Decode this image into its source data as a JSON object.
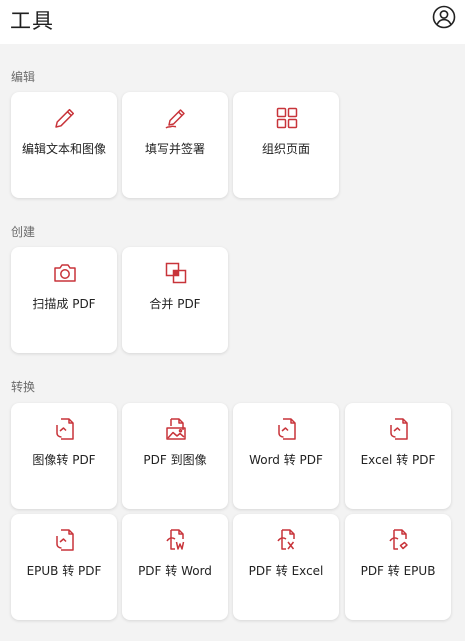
{
  "header": {
    "title": "工具"
  },
  "sections": {
    "edit": {
      "label": "编辑",
      "items": [
        "编辑文本和图像",
        "填写并签署",
        "组织页面"
      ]
    },
    "create": {
      "label": "创建",
      "items": [
        "扫描成 PDF",
        "合并 PDF"
      ]
    },
    "convert": {
      "label": "转换",
      "items": [
        "图像转 PDF",
        "PDF 到图像",
        "Word 转 PDF",
        "Excel 转 PDF",
        "EPUB 转 PDF",
        "PDF 转 Word",
        "PDF 转 Excel",
        "PDF 转 EPUB"
      ]
    }
  },
  "icons": {
    "edit": [
      "pencil-icon",
      "pen-sign-icon",
      "grid-icon"
    ],
    "create": [
      "camera-icon",
      "merge-icon"
    ],
    "convert": [
      "image-to-pdf-icon",
      "pdf-to-image-icon",
      "word-to-pdf-icon",
      "excel-to-pdf-icon",
      "epub-to-pdf-icon",
      "pdf-to-word-icon",
      "pdf-to-excel-icon",
      "pdf-to-epub-icon"
    ]
  },
  "colors": {
    "accent": "#c8343a",
    "background": "#f3f3f3",
    "card": "#ffffff"
  }
}
